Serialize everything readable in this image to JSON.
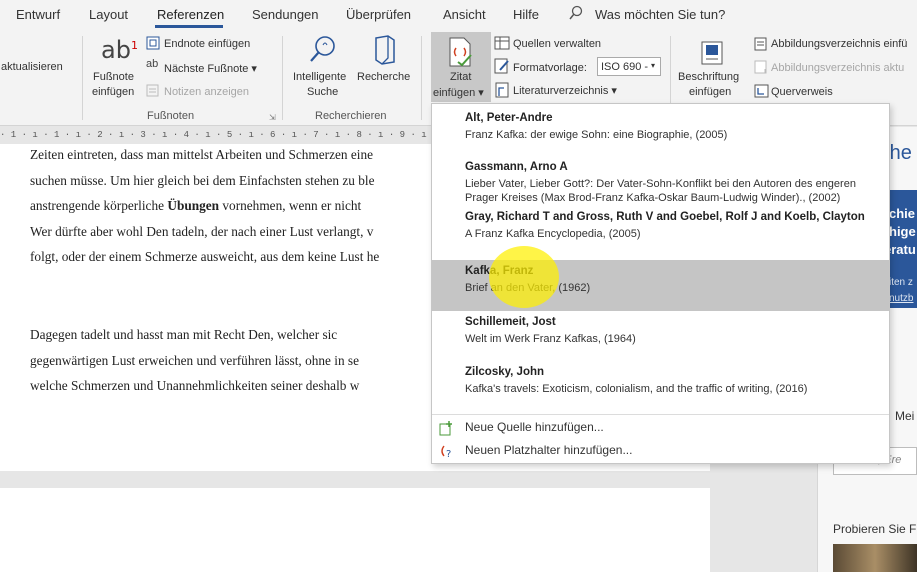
{
  "tabs": [
    "Entwurf",
    "Layout",
    "Referenzen",
    "Sendungen",
    "Überprüfen",
    "Ansicht",
    "Hilfe"
  ],
  "tell_me": "Was möchten Sie tun?",
  "ribbon": {
    "toc_update": "aktualisieren",
    "footnote_insert": [
      "Fußnote",
      "einfügen"
    ],
    "endnote_insert": "Endnote einfügen",
    "next_footnote": "Nächste Fußnote",
    "show_notes": "Notizen anzeigen",
    "group_footnotes": "Fußnoten",
    "smart_lookup": [
      "Intelligente",
      "Suche"
    ],
    "researcher": "Recherche",
    "group_research": "Recherchieren",
    "cite_insert": [
      "Zitat",
      "einfügen"
    ],
    "manage_sources": "Quellen verwalten",
    "style_label": "Formatvorlage:",
    "style_value": "ISO 690 -",
    "bibliography": "Literaturverzeichnis",
    "caption_insert": [
      "Beschriftung",
      "einfügen"
    ],
    "table_of_figures": "Abbildungsverzeichnis einfü",
    "update_table": "Abbildungsverzeichnis aktu",
    "cross_reference": "Querverweis"
  },
  "ruler": "· 1 · ı · 1 · ı · 2 · ı · 3 · ı · 4 · ı · 5 · ı · 6 · ı · 7 · ı · 8 · ı · 9 · ı · 10 · ı",
  "document": {
    "lines": [
      "Zeiten eintreten, dass man mittelst Arbeiten und Schmerzen eine",
      "suchen müsse. Um hier gleich bei dem Einfachsten stehen zu ble",
      "anstrengende körperliche ",
      "Übungen",
      " vornehmen, wenn er nicht",
      "Wer dürfte aber wohl Den tadeln, der nach einer Lust verlangt, v",
      "folgt, oder der einem Schmerze ausweicht, aus dem keine Lust he",
      "Dagegen  tadelt  und  hasst  man  mit  Recht  Den,  welcher  sic",
      "gegenwärtigen Lust erweichen und verführen lässt, ohne in se",
      "welche  Schmerzen  und  Unannehmlichkeiten  seiner  deshalb  w"
    ]
  },
  "citations": [
    {
      "author": "Alt, Peter-Andre",
      "detail": [
        "Franz Kafka: der ewige Sohn: eine Biographie, (2005)"
      ]
    },
    {
      "author": "Gassmann, Arno A",
      "detail": [
        "Lieber Vater, Lieber Gott?: Der Vater-Sohn-Konflikt bei den Autoren des engeren",
        "Prager Kreises (Max Brod-Franz Kafka-Oskar Baum-Ludwig Winder)., (2002)"
      ]
    },
    {
      "author": "Gray, Richard T and Gross, Ruth V and Goebel, Rolf J and Koelb, Clayton",
      "detail": [
        "A Franz Kafka Encyclopedia, (2005)"
      ]
    },
    {
      "author": "Kafka, Franz",
      "detail": [
        "Brief an den Vater, (1962)"
      ]
    },
    {
      "author": "Schillemeit, Jost",
      "detail": [
        "Welt im Werk Franz Kafkas, (1964)"
      ]
    },
    {
      "author": "Zilcosky, John",
      "detail": [
        "Kafka's travels: Exoticism, colonialism, and the traffic of writing, (2016)"
      ]
    }
  ],
  "actions": {
    "new_source": "Neue Quelle hinzufügen...",
    "new_placeholder": "Neuen Platzhalter hinzufügen..."
  },
  "pane": {
    "title": "rche",
    "blue_lines": [
      "chie",
      "hige",
      "eratu"
    ],
    "blue_small": [
      "iten z",
      "nutzb"
    ],
    "tab_label": "Mei",
    "search_placeholder": "n, Ere",
    "probieren": "Probieren Sie F"
  },
  "colors": {
    "accent": "#2b579a",
    "highlight": "#c5c5c5",
    "cursor": "#fff000"
  }
}
